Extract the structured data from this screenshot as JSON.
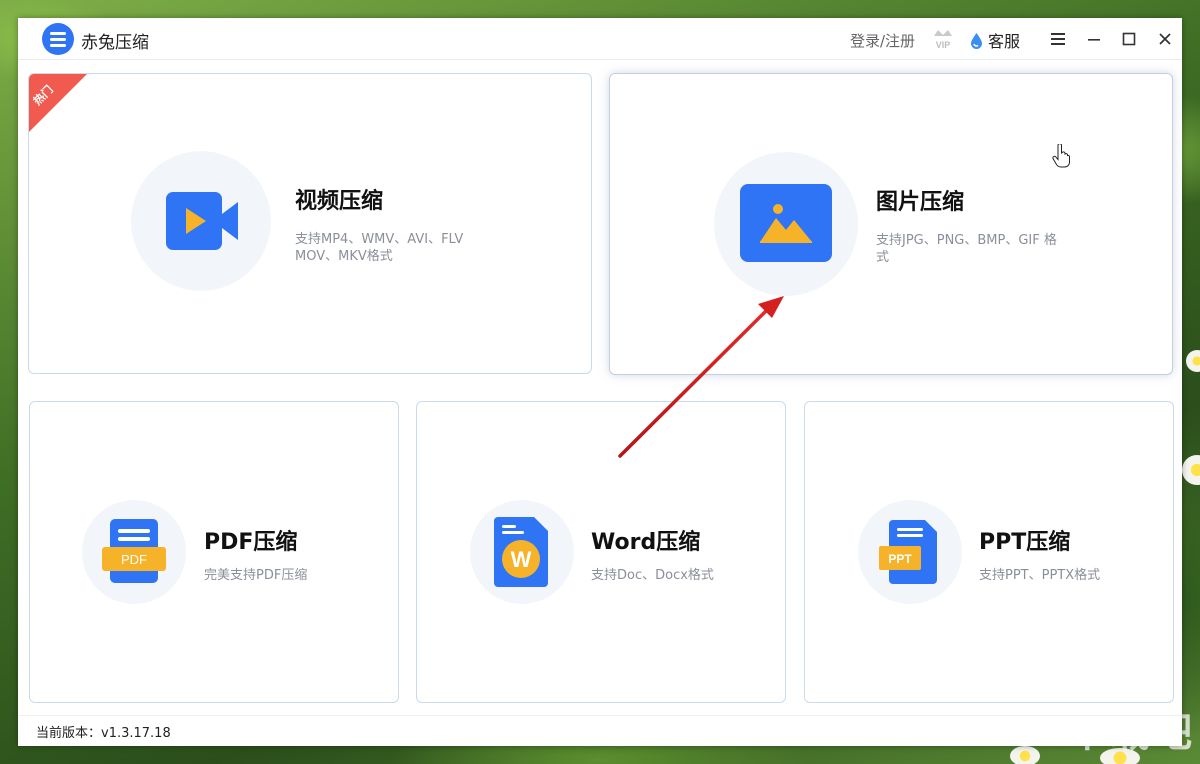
{
  "window": {
    "title": "赤兔压缩",
    "login_label": "登录/注册",
    "vip_label": "VIP",
    "service_label": "客服"
  },
  "cards": {
    "video": {
      "title": "视频压缩",
      "desc_line1": "支持MP4、WMV、AVI、FLV",
      "desc_line2": "MOV、MKV格式",
      "badge": "热门"
    },
    "image": {
      "title": "图片压缩",
      "desc_line1": "支持JPG、PNG、BMP、GIF 格",
      "desc_line2": "式"
    },
    "pdf": {
      "title": "PDF压缩",
      "desc": "完美支持PDF压缩",
      "icon_text": "PDF"
    },
    "word": {
      "title": "Word压缩",
      "desc": "支持Doc、Docx格式",
      "icon_text": "W"
    },
    "ppt": {
      "title": "PPT压缩",
      "desc": "支持PPT、PPTX格式",
      "icon_text": "PPT"
    }
  },
  "footer": {
    "version": "当前版本：v1.3.17.18"
  },
  "watermark": "下载吧",
  "colors": {
    "accent_blue": "#2f74f5",
    "badge_red": "#f05a4f",
    "doc_yellow": "#f6b32a",
    "annotation_arrow": "#cc1f1f"
  }
}
